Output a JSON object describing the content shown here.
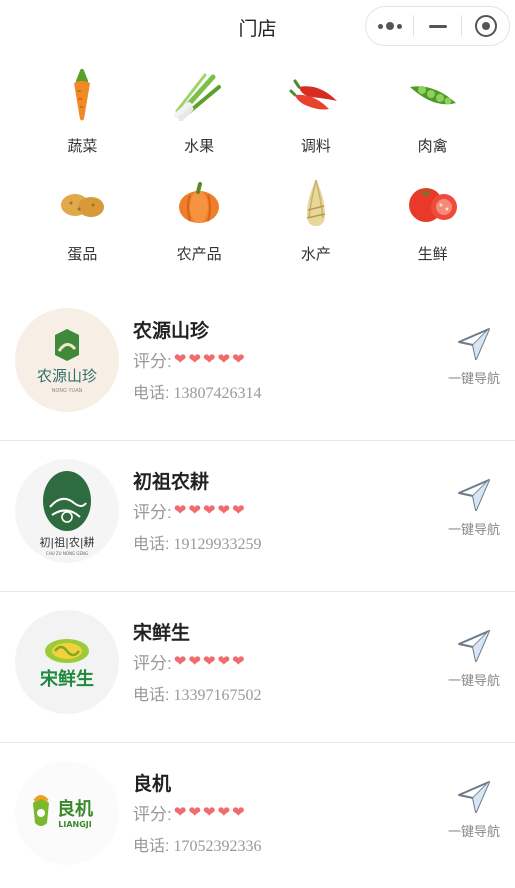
{
  "header": {
    "title": "门店"
  },
  "categories": [
    {
      "label": "蔬菜",
      "icon": "carrot-icon"
    },
    {
      "label": "水果",
      "icon": "scallion-icon"
    },
    {
      "label": "调料",
      "icon": "chili-pepper-icon"
    },
    {
      "label": "肉禽",
      "icon": "pea-pod-icon"
    },
    {
      "label": "蛋品",
      "icon": "potato-icon"
    },
    {
      "label": "农产品",
      "icon": "pumpkin-icon"
    },
    {
      "label": "水产",
      "icon": "bamboo-shoot-icon"
    },
    {
      "label": "生鲜",
      "icon": "tomato-icon"
    }
  ],
  "stores": [
    {
      "name": "农源山珍",
      "rating_label": "评分:",
      "rating": 5,
      "phone_label": "电话:",
      "phone": "13807426314",
      "nav_label": "一键导航",
      "logo_text": "农源山珍",
      "logo_sub": "NONG YUAN"
    },
    {
      "name": "初祖农耕",
      "rating_label": "评分:",
      "rating": 5,
      "phone_label": "电话:",
      "phone": "19129933259",
      "nav_label": "一键导航",
      "logo_text": "初|祖|农|耕",
      "logo_sub": "CHU ZU NONG GENG"
    },
    {
      "name": "宋鲜生",
      "rating_label": "评分:",
      "rating": 5,
      "phone_label": "电话:",
      "phone": "13397167502",
      "nav_label": "一键导航",
      "logo_text": "宋鲜生",
      "logo_sub": ""
    },
    {
      "name": "良机",
      "rating_label": "评分:",
      "rating": 5,
      "phone_label": "电话:",
      "phone": "17052392336",
      "nav_label": "一键导航",
      "logo_text": "良机",
      "logo_sub": "LIANGJI"
    }
  ],
  "colors": {
    "heart": "#f06b6b",
    "muted_text": "#999999",
    "divider": "#e6e6e6"
  }
}
